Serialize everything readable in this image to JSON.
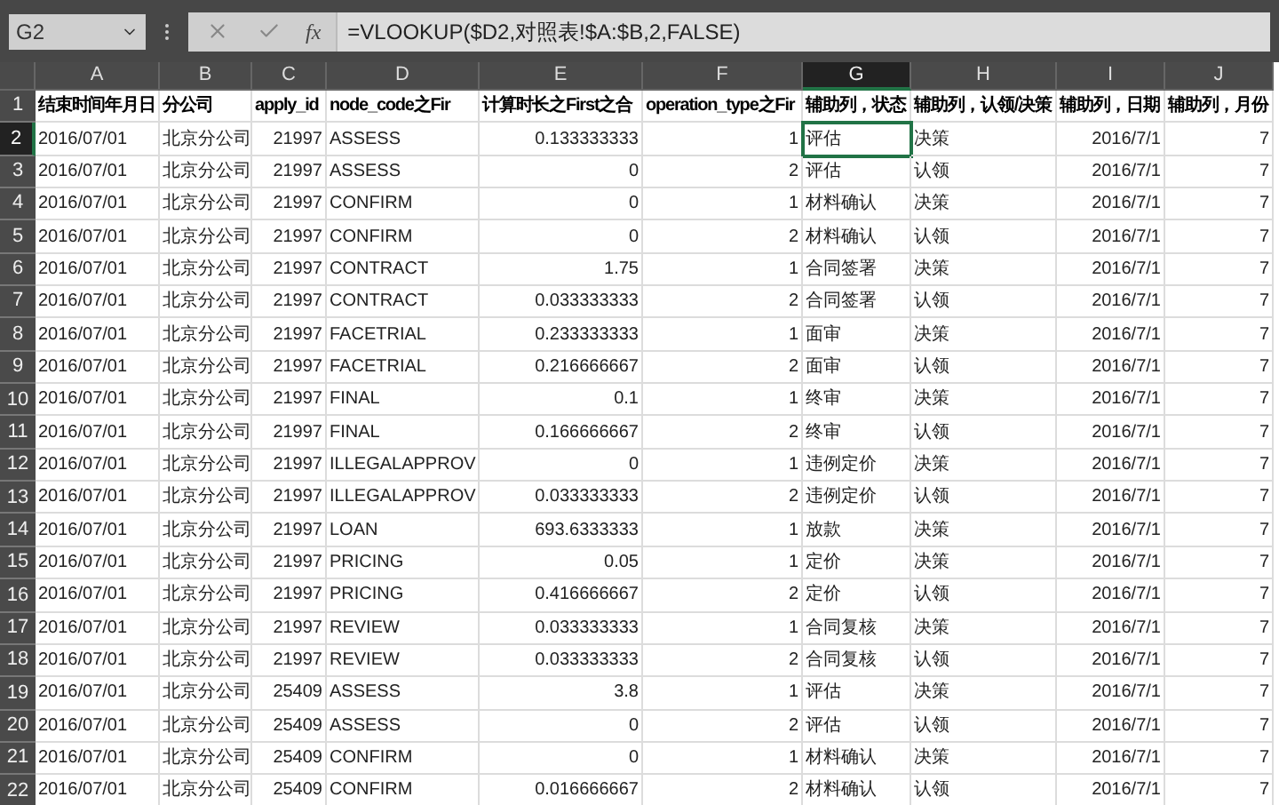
{
  "name_box": "G2",
  "function_label": "fx",
  "formula": "=VLOOKUP($D2,对照表!$A:$B,2,FALSE)",
  "columns": [
    {
      "letter": "A",
      "selected": false
    },
    {
      "letter": "B",
      "selected": false
    },
    {
      "letter": "C",
      "selected": false
    },
    {
      "letter": "D",
      "selected": false
    },
    {
      "letter": "E",
      "selected": false
    },
    {
      "letter": "F",
      "selected": false
    },
    {
      "letter": "G",
      "selected": true
    },
    {
      "letter": "H",
      "selected": false
    },
    {
      "letter": "I",
      "selected": false
    },
    {
      "letter": "J",
      "selected": false
    }
  ],
  "header_row": {
    "number": "1",
    "selected": false,
    "cells": [
      "结束时间年月日",
      "分公司",
      "apply_id",
      "node_code之Fir",
      "计算时长之First之合",
      "operation_type之Fir",
      "辅助列，状态",
      "辅助列，认领/决策",
      "辅助列，日期",
      "辅助列，月份"
    ]
  },
  "rows": [
    {
      "number": "2",
      "selected": true,
      "cells": [
        "2016/07/01",
        "北京分公司",
        "21997",
        "ASSESS",
        "0.133333333",
        "1",
        "评估",
        "决策",
        "2016/7/1",
        "7"
      ]
    },
    {
      "number": "3",
      "selected": false,
      "cells": [
        "2016/07/01",
        "北京分公司",
        "21997",
        "ASSESS",
        "0",
        "2",
        "评估",
        "认领",
        "2016/7/1",
        "7"
      ]
    },
    {
      "number": "4",
      "selected": false,
      "cells": [
        "2016/07/01",
        "北京分公司",
        "21997",
        "CONFIRM",
        "0",
        "1",
        "材料确认",
        "决策",
        "2016/7/1",
        "7"
      ]
    },
    {
      "number": "5",
      "selected": false,
      "cells": [
        "2016/07/01",
        "北京分公司",
        "21997",
        "CONFIRM",
        "0",
        "2",
        "材料确认",
        "认领",
        "2016/7/1",
        "7"
      ]
    },
    {
      "number": "6",
      "selected": false,
      "cells": [
        "2016/07/01",
        "北京分公司",
        "21997",
        "CONTRACT",
        "1.75",
        "1",
        "合同签署",
        "决策",
        "2016/7/1",
        "7"
      ]
    },
    {
      "number": "7",
      "selected": false,
      "cells": [
        "2016/07/01",
        "北京分公司",
        "21997",
        "CONTRACT",
        "0.033333333",
        "2",
        "合同签署",
        "认领",
        "2016/7/1",
        "7"
      ]
    },
    {
      "number": "8",
      "selected": false,
      "cells": [
        "2016/07/01",
        "北京分公司",
        "21997",
        "FACETRIAL",
        "0.233333333",
        "1",
        "面审",
        "决策",
        "2016/7/1",
        "7"
      ]
    },
    {
      "number": "9",
      "selected": false,
      "cells": [
        "2016/07/01",
        "北京分公司",
        "21997",
        "FACETRIAL",
        "0.216666667",
        "2",
        "面审",
        "认领",
        "2016/7/1",
        "7"
      ]
    },
    {
      "number": "10",
      "selected": false,
      "cells": [
        "2016/07/01",
        "北京分公司",
        "21997",
        "FINAL",
        "0.1",
        "1",
        "终审",
        "决策",
        "2016/7/1",
        "7"
      ]
    },
    {
      "number": "11",
      "selected": false,
      "cells": [
        "2016/07/01",
        "北京分公司",
        "21997",
        "FINAL",
        "0.166666667",
        "2",
        "终审",
        "认领",
        "2016/7/1",
        "7"
      ]
    },
    {
      "number": "12",
      "selected": false,
      "cells": [
        "2016/07/01",
        "北京分公司",
        "21997",
        "ILLEGALAPPROV",
        "0",
        "1",
        "违例定价",
        "决策",
        "2016/7/1",
        "7"
      ]
    },
    {
      "number": "13",
      "selected": false,
      "cells": [
        "2016/07/01",
        "北京分公司",
        "21997",
        "ILLEGALAPPROV",
        "0.033333333",
        "2",
        "违例定价",
        "认领",
        "2016/7/1",
        "7"
      ]
    },
    {
      "number": "14",
      "selected": false,
      "cells": [
        "2016/07/01",
        "北京分公司",
        "21997",
        "LOAN",
        "693.6333333",
        "1",
        "放款",
        "决策",
        "2016/7/1",
        "7"
      ]
    },
    {
      "number": "15",
      "selected": false,
      "cells": [
        "2016/07/01",
        "北京分公司",
        "21997",
        "PRICING",
        "0.05",
        "1",
        "定价",
        "决策",
        "2016/7/1",
        "7"
      ]
    },
    {
      "number": "16",
      "selected": false,
      "cells": [
        "2016/07/01",
        "北京分公司",
        "21997",
        "PRICING",
        "0.416666667",
        "2",
        "定价",
        "认领",
        "2016/7/1",
        "7"
      ]
    },
    {
      "number": "17",
      "selected": false,
      "cells": [
        "2016/07/01",
        "北京分公司",
        "21997",
        "REVIEW",
        "0.033333333",
        "1",
        "合同复核",
        "决策",
        "2016/7/1",
        "7"
      ]
    },
    {
      "number": "18",
      "selected": false,
      "cells": [
        "2016/07/01",
        "北京分公司",
        "21997",
        "REVIEW",
        "0.033333333",
        "2",
        "合同复核",
        "认领",
        "2016/7/1",
        "7"
      ]
    },
    {
      "number": "19",
      "selected": false,
      "cells": [
        "2016/07/01",
        "北京分公司",
        "25409",
        "ASSESS",
        "3.8",
        "1",
        "评估",
        "决策",
        "2016/7/1",
        "7"
      ]
    },
    {
      "number": "20",
      "selected": false,
      "cells": [
        "2016/07/01",
        "北京分公司",
        "25409",
        "ASSESS",
        "0",
        "2",
        "评估",
        "认领",
        "2016/7/1",
        "7"
      ]
    },
    {
      "number": "21",
      "selected": false,
      "cells": [
        "2016/07/01",
        "北京分公司",
        "25409",
        "CONFIRM",
        "0",
        "1",
        "材料确认",
        "决策",
        "2016/7/1",
        "7"
      ]
    },
    {
      "number": "22",
      "selected": false,
      "cells": [
        "2016/07/01",
        "北京分公司",
        "25409",
        "CONFIRM",
        "0.016666667",
        "2",
        "材料确认",
        "认领",
        "2016/7/1",
        "7"
      ]
    }
  ]
}
